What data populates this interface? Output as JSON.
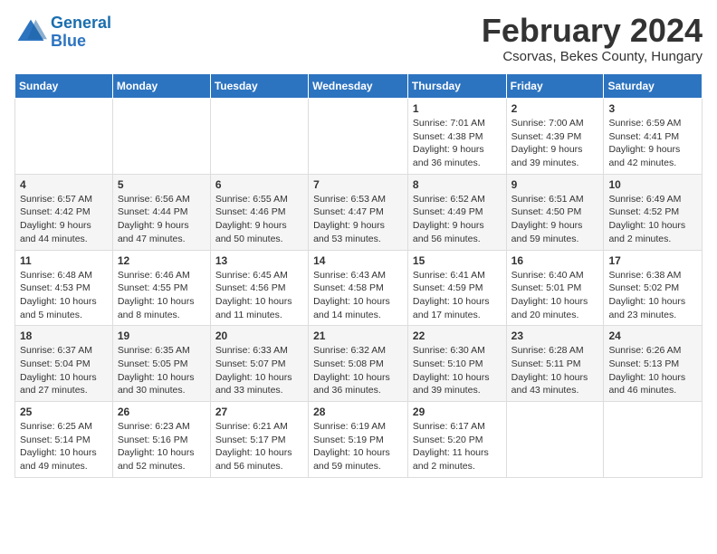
{
  "header": {
    "logo_line1": "General",
    "logo_line2": "Blue",
    "month_title": "February 2024",
    "location": "Csorvas, Bekes County, Hungary"
  },
  "days_of_week": [
    "Sunday",
    "Monday",
    "Tuesday",
    "Wednesday",
    "Thursday",
    "Friday",
    "Saturday"
  ],
  "weeks": [
    [
      {
        "day": "",
        "info": ""
      },
      {
        "day": "",
        "info": ""
      },
      {
        "day": "",
        "info": ""
      },
      {
        "day": "",
        "info": ""
      },
      {
        "day": "1",
        "info": "Sunrise: 7:01 AM\nSunset: 4:38 PM\nDaylight: 9 hours\nand 36 minutes."
      },
      {
        "day": "2",
        "info": "Sunrise: 7:00 AM\nSunset: 4:39 PM\nDaylight: 9 hours\nand 39 minutes."
      },
      {
        "day": "3",
        "info": "Sunrise: 6:59 AM\nSunset: 4:41 PM\nDaylight: 9 hours\nand 42 minutes."
      }
    ],
    [
      {
        "day": "4",
        "info": "Sunrise: 6:57 AM\nSunset: 4:42 PM\nDaylight: 9 hours\nand 44 minutes."
      },
      {
        "day": "5",
        "info": "Sunrise: 6:56 AM\nSunset: 4:44 PM\nDaylight: 9 hours\nand 47 minutes."
      },
      {
        "day": "6",
        "info": "Sunrise: 6:55 AM\nSunset: 4:46 PM\nDaylight: 9 hours\nand 50 minutes."
      },
      {
        "day": "7",
        "info": "Sunrise: 6:53 AM\nSunset: 4:47 PM\nDaylight: 9 hours\nand 53 minutes."
      },
      {
        "day": "8",
        "info": "Sunrise: 6:52 AM\nSunset: 4:49 PM\nDaylight: 9 hours\nand 56 minutes."
      },
      {
        "day": "9",
        "info": "Sunrise: 6:51 AM\nSunset: 4:50 PM\nDaylight: 9 hours\nand 59 minutes."
      },
      {
        "day": "10",
        "info": "Sunrise: 6:49 AM\nSunset: 4:52 PM\nDaylight: 10 hours\nand 2 minutes."
      }
    ],
    [
      {
        "day": "11",
        "info": "Sunrise: 6:48 AM\nSunset: 4:53 PM\nDaylight: 10 hours\nand 5 minutes."
      },
      {
        "day": "12",
        "info": "Sunrise: 6:46 AM\nSunset: 4:55 PM\nDaylight: 10 hours\nand 8 minutes."
      },
      {
        "day": "13",
        "info": "Sunrise: 6:45 AM\nSunset: 4:56 PM\nDaylight: 10 hours\nand 11 minutes."
      },
      {
        "day": "14",
        "info": "Sunrise: 6:43 AM\nSunset: 4:58 PM\nDaylight: 10 hours\nand 14 minutes."
      },
      {
        "day": "15",
        "info": "Sunrise: 6:41 AM\nSunset: 4:59 PM\nDaylight: 10 hours\nand 17 minutes."
      },
      {
        "day": "16",
        "info": "Sunrise: 6:40 AM\nSunset: 5:01 PM\nDaylight: 10 hours\nand 20 minutes."
      },
      {
        "day": "17",
        "info": "Sunrise: 6:38 AM\nSunset: 5:02 PM\nDaylight: 10 hours\nand 23 minutes."
      }
    ],
    [
      {
        "day": "18",
        "info": "Sunrise: 6:37 AM\nSunset: 5:04 PM\nDaylight: 10 hours\nand 27 minutes."
      },
      {
        "day": "19",
        "info": "Sunrise: 6:35 AM\nSunset: 5:05 PM\nDaylight: 10 hours\nand 30 minutes."
      },
      {
        "day": "20",
        "info": "Sunrise: 6:33 AM\nSunset: 5:07 PM\nDaylight: 10 hours\nand 33 minutes."
      },
      {
        "day": "21",
        "info": "Sunrise: 6:32 AM\nSunset: 5:08 PM\nDaylight: 10 hours\nand 36 minutes."
      },
      {
        "day": "22",
        "info": "Sunrise: 6:30 AM\nSunset: 5:10 PM\nDaylight: 10 hours\nand 39 minutes."
      },
      {
        "day": "23",
        "info": "Sunrise: 6:28 AM\nSunset: 5:11 PM\nDaylight: 10 hours\nand 43 minutes."
      },
      {
        "day": "24",
        "info": "Sunrise: 6:26 AM\nSunset: 5:13 PM\nDaylight: 10 hours\nand 46 minutes."
      }
    ],
    [
      {
        "day": "25",
        "info": "Sunrise: 6:25 AM\nSunset: 5:14 PM\nDaylight: 10 hours\nand 49 minutes."
      },
      {
        "day": "26",
        "info": "Sunrise: 6:23 AM\nSunset: 5:16 PM\nDaylight: 10 hours\nand 52 minutes."
      },
      {
        "day": "27",
        "info": "Sunrise: 6:21 AM\nSunset: 5:17 PM\nDaylight: 10 hours\nand 56 minutes."
      },
      {
        "day": "28",
        "info": "Sunrise: 6:19 AM\nSunset: 5:19 PM\nDaylight: 10 hours\nand 59 minutes."
      },
      {
        "day": "29",
        "info": "Sunrise: 6:17 AM\nSunset: 5:20 PM\nDaylight: 11 hours\nand 2 minutes."
      },
      {
        "day": "",
        "info": ""
      },
      {
        "day": "",
        "info": ""
      }
    ]
  ]
}
